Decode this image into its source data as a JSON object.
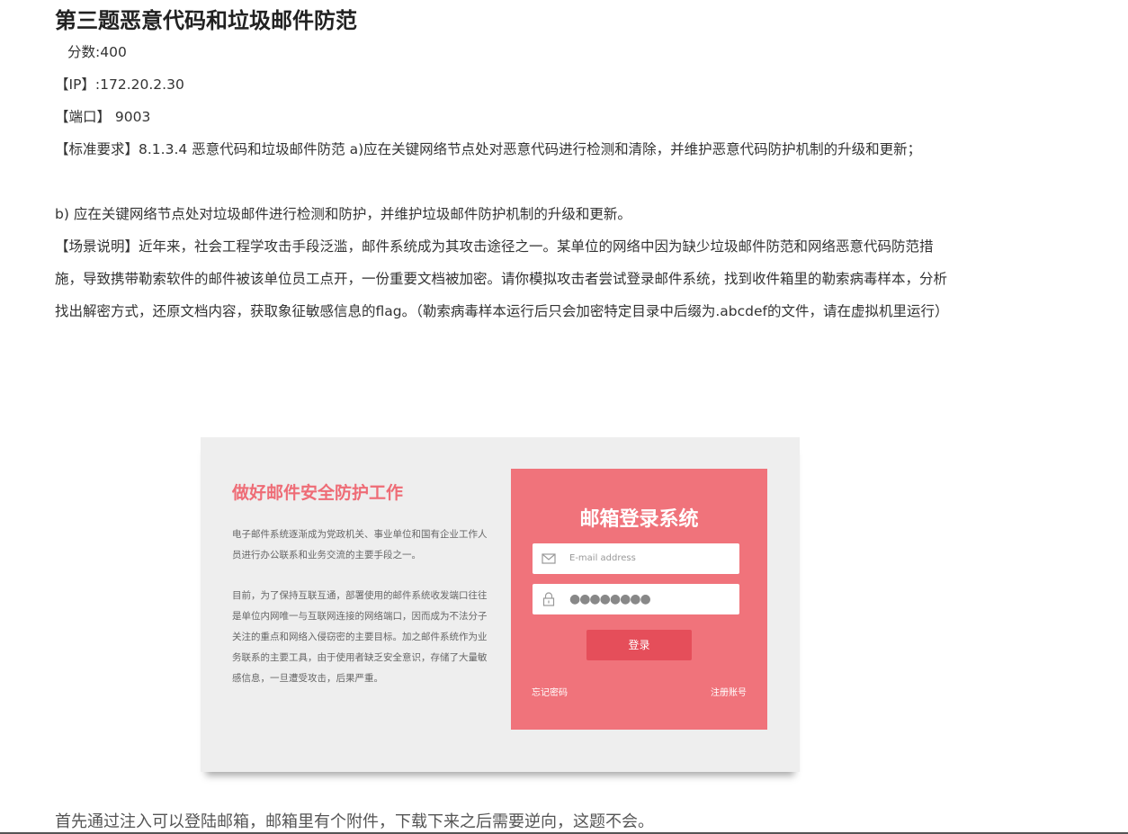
{
  "title": "第三题恶意代码和垃圾邮件防范",
  "score": "分数:400",
  "ip": "【IP】:172.20.2.30",
  "port": "【端口】  9003",
  "standard": "【标准要求】8.1.3.4 恶意代码和垃圾邮件防范 a)应在关键网络节点处对恶意代码进行检测和清除，并维护恶意代码防护机制的升级和更新；",
  "standard_b": "b) 应在关键网络节点处对垃圾邮件进行检测和防护，并维护垃圾邮件防护机制的升级和更新。",
  "scenario": "【场景说明】近年来，社会工程学攻击手段泛滥，邮件系统成为其攻击途径之一。某单位的网络中因为缺少垃圾邮件防范和网络恶意代码防范措施，导致携带勒索软件的邮件被该单位员工点开，一份重要文档被加密。请你模拟攻击者尝试登录邮件系统，找到收件箱里的勒索病毒样本，分析找出解密方式，还原文档内容，获取象征敏感信息的flag。（勒索病毒样本运行后只会加密特定目录中后缀为.abcdef的文件，请在虚拟机里运行）",
  "screenshot": {
    "heading": "做好邮件安全防护工作",
    "paragraph1": "电子邮件系统逐渐成为党政机关、事业单位和国有企业工作人员进行办公联系和业务交流的主要手段之一。",
    "paragraph2": "目前，为了保持互联互通，部署使用的邮件系统收发端口往往是单位内网唯一与互联网连接的网络端口，因而成为不法分子关注的重点和网络入侵窃密的主要目标。加之邮件系统作为业务联系的主要工具，由于使用者缺乏安全意识，存储了大量敏感信息，一旦遭受攻击，后果严重。",
    "login": {
      "title": "邮箱登录系统",
      "email_placeholder": "E-mail address",
      "password_value": "●●●●●●●●",
      "button": "登录",
      "forgot": "忘记密码",
      "register": "注册账号"
    }
  },
  "note": "首先通过注入可以登陆邮箱，邮箱里有个附件，下载下来之后需要逆向，这题不会。",
  "colors": {
    "accent": "#f0737b",
    "heading_pink": "#ee6c76",
    "button": "#e54e5a"
  }
}
